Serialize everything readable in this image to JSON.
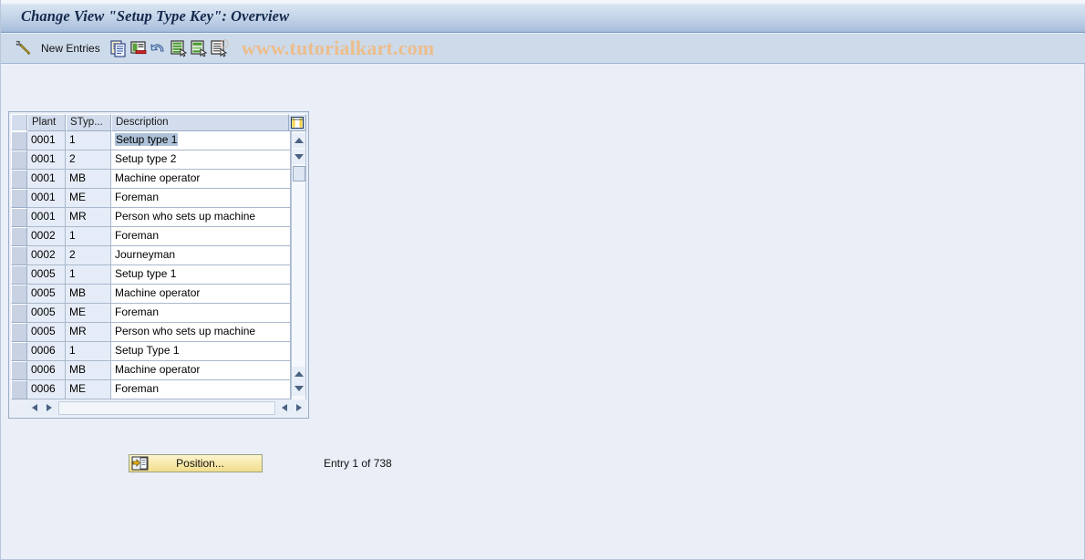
{
  "window": {
    "title": "Change View \"Setup Type Key\": Overview"
  },
  "toolbar": {
    "new_entries_label": "New Entries",
    "icons": [
      {
        "name": "pencil-display-change-icon",
        "title": "Display/Change"
      },
      {
        "name": "copy-as-icon",
        "title": "Copy As..."
      },
      {
        "name": "delete-icon",
        "title": "Delete"
      },
      {
        "name": "undo-icon",
        "title": "Undo Change"
      },
      {
        "name": "select-all-icon",
        "title": "Select All"
      },
      {
        "name": "select-block-icon",
        "title": "Select Block"
      },
      {
        "name": "deselect-all-icon",
        "title": "Deselect All"
      }
    ],
    "watermark": "www.tutorialkart.com"
  },
  "table": {
    "settings_icon": "table-settings-icon",
    "columns": [
      "Plant",
      "STyp...",
      "Description"
    ],
    "rows": [
      {
        "plant": "0001",
        "stype": "1",
        "description": "Setup type 1",
        "selected": true
      },
      {
        "plant": "0001",
        "stype": "2",
        "description": "Setup type 2",
        "selected": false
      },
      {
        "plant": "0001",
        "stype": "MB",
        "description": "Machine operator",
        "selected": false
      },
      {
        "plant": "0001",
        "stype": "ME",
        "description": "Foreman",
        "selected": false
      },
      {
        "plant": "0001",
        "stype": "MR",
        "description": "Person who sets up machine",
        "selected": false
      },
      {
        "plant": "0002",
        "stype": "1",
        "description": "Foreman",
        "selected": false
      },
      {
        "plant": "0002",
        "stype": "2",
        "description": "Journeyman",
        "selected": false
      },
      {
        "plant": "0005",
        "stype": "1",
        "description": "Setup type 1",
        "selected": false
      },
      {
        "plant": "0005",
        "stype": "MB",
        "description": "Machine operator",
        "selected": false
      },
      {
        "plant": "0005",
        "stype": "ME",
        "description": "Foreman",
        "selected": false
      },
      {
        "plant": "0005",
        "stype": "MR",
        "description": "Person who sets up machine",
        "selected": false
      },
      {
        "plant": "0006",
        "stype": "1",
        "description": "Setup Type 1",
        "selected": false
      },
      {
        "plant": "0006",
        "stype": "MB",
        "description": "Machine operator",
        "selected": false
      },
      {
        "plant": "0006",
        "stype": "ME",
        "description": "Foreman",
        "selected": false
      }
    ]
  },
  "footer": {
    "position_button_label": "Position...",
    "position_button_icon": "position-goto-icon",
    "entry_status": "Entry 1 of 738"
  }
}
